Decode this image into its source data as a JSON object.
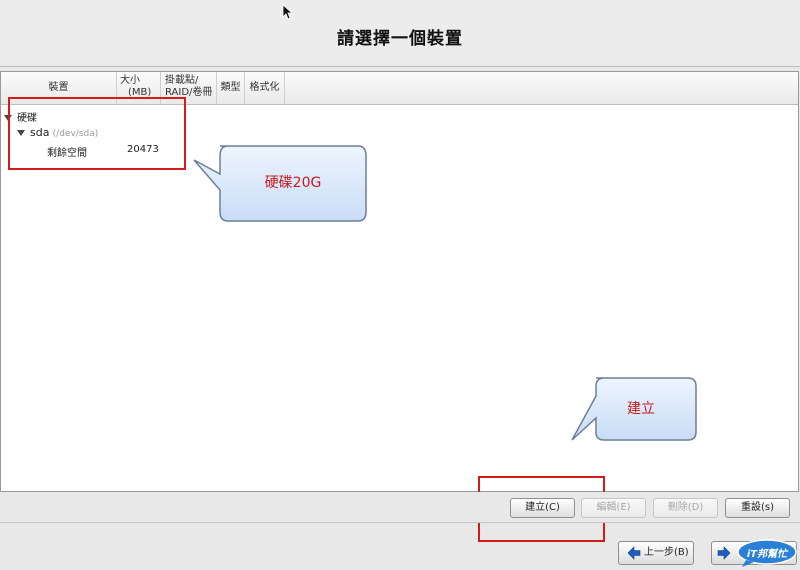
{
  "header": {
    "title": "請選擇一個裝置"
  },
  "table": {
    "columns": {
      "device": "裝置",
      "size_line1": "大小",
      "size_line2": "(MB)",
      "mount_line1": "掛載點/",
      "mount_line2": "RAID/卷冊",
      "type": "類型",
      "format": "格式化"
    },
    "tree": {
      "group_label": "硬碟",
      "disk_label": "sda",
      "disk_path": "(/dev/sda)",
      "free_label": "剩餘空間",
      "free_size": "20473"
    }
  },
  "annotations": {
    "disk_note": "硬碟20G",
    "create_note": "建立"
  },
  "buttons": {
    "create": "建立(C)",
    "edit": "編輯(E)",
    "delete": "刪除(D)",
    "reset": "重設(s)"
  },
  "nav": {
    "back": "上一步(B)"
  },
  "logo": {
    "text": "iT邦幫忙"
  },
  "colors": {
    "annotation_red": "#d21c1c",
    "callout_fill": "#dce9fb",
    "arrow_blue": "#1f5fbf"
  }
}
